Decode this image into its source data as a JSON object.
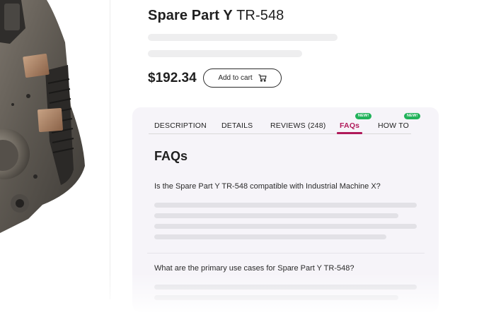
{
  "product": {
    "name_bold": "Spare Part Y",
    "name_model": "TR-548",
    "price": "$192.34",
    "add_to_cart_label": "Add to cart"
  },
  "tabs": [
    {
      "label": "DESCRIPTION",
      "active": false,
      "badge": ""
    },
    {
      "label": "DETAILS",
      "active": false,
      "badge": ""
    },
    {
      "label": "REVIEWS (248)",
      "active": false,
      "badge": ""
    },
    {
      "label": "FAQs",
      "active": true,
      "badge": "NEW!"
    },
    {
      "label": "HOW TO",
      "active": false,
      "badge": "NEW!"
    }
  ],
  "faq": {
    "heading": "FAQs",
    "questions": [
      "Is the Spare Part Y TR-548 compatible with Industrial Machine X?",
      "What are the primary use cases for Spare Part Y TR-548?"
    ]
  },
  "colors": {
    "accent": "#b0195a",
    "badge": "#21b25a",
    "card_background": "#f6f4f9",
    "skeleton": "#eeeeef"
  },
  "icons": [
    "cart-icon"
  ]
}
